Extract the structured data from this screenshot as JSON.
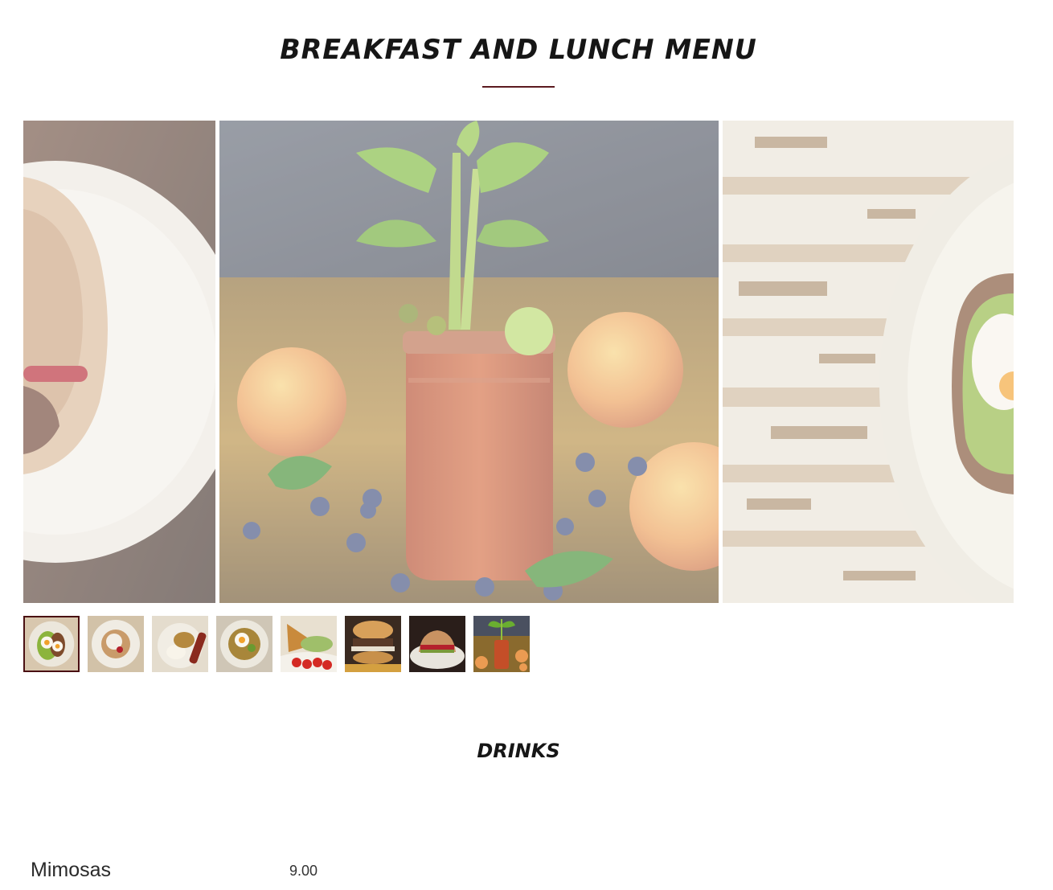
{
  "page": {
    "title": "BREAKFAST AND LUNCH MENU"
  },
  "gallery": {
    "slides": [
      {
        "icon": "sandwich-photo"
      },
      {
        "icon": "bloody-mary-photo"
      },
      {
        "icon": "avocado-toast-photo"
      }
    ],
    "active_thumbnail": 1,
    "thumbnails": [
      "avocado-toast-thumb",
      "bowl-thumb",
      "breakfast-plate-thumb",
      "egg-bowl-thumb",
      "salad-thumb",
      "burger-thumb",
      "sandwich-thumb",
      "bloody-mary-thumb"
    ],
    "accent_color": "#4a0f12"
  },
  "drinks": {
    "title": "DRINKS",
    "items": [
      {
        "name": "Mimosas",
        "price": "9.00"
      }
    ]
  }
}
